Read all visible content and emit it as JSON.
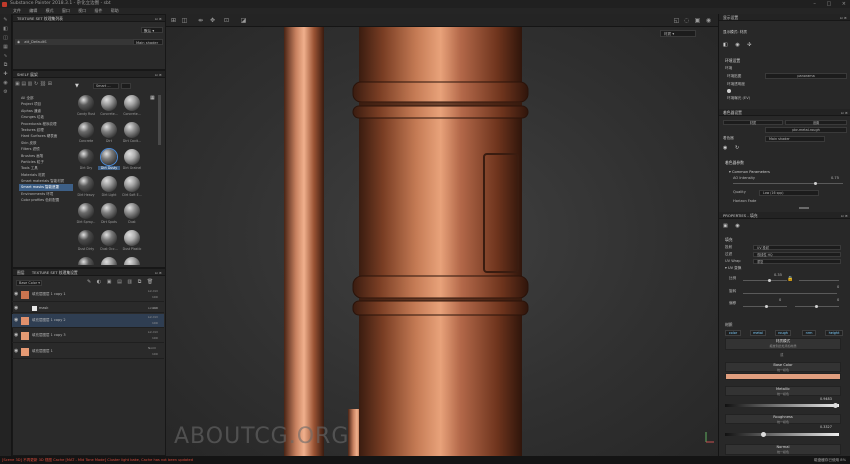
{
  "app": {
    "title": "Substance Painter 2018.3.1 - 杂化立边圈 - sbt",
    "menu": [
      "文件",
      "编辑",
      "模式",
      "窗口",
      "视口",
      "插件",
      "帮助"
    ]
  },
  "texture_set_list": {
    "header": "TEXTURE SET 纹理集列表",
    "dropdown": "默认",
    "item_name": "att_DefaultS",
    "item_shader": "Main shader"
  },
  "shelf": {
    "header": "SHELF 展架",
    "filter": "Smart ...",
    "categories": [
      "All 全部",
      "Project 项目",
      "Alphas 通道",
      "Grunges 垃圾",
      "Procedurals 程序纹理",
      "Textures 纹理",
      "Hard Surfaces 硬表面",
      "Skin 皮肤",
      "Filters 滤镜",
      "Brushes 画笔",
      "Particles 粒子",
      "Tools 工具",
      "Materials 材质",
      "Smart materials 智能材质",
      "Smart masks 智能遮罩",
      "Environments 环境",
      "Color profiles 色彩配置"
    ],
    "selected_category": "Smart masks 智能遮罩",
    "thumbnails": [
      "Candy Rust",
      "Concrete...",
      "Concrete...",
      "Concrete",
      "Dirt",
      "Dirt Cavit...",
      "Dirt Dry",
      "Dirt Dusty",
      "Dirt Grainel",
      "Dirt Heavy",
      "Dirt Light",
      "Dirt Soft E...",
      "Dirt Spray...",
      "Dirt Spots",
      "Dust",
      "Dust Dirty",
      "Dust Occ...",
      "Dust Plastic",
      "",
      "",
      ""
    ],
    "selected_thumbnail": "Dirt Dusty"
  },
  "layers": {
    "tab_layers": "图层",
    "tab_texture_settings": "TEXTURE SET 纹理集设置",
    "channel_dropdown": "Base Color",
    "items": [
      {
        "name": "填充层图层 1 copy 1",
        "blend": "Lin Dd",
        "opacity": "100",
        "color": "#c9744f"
      },
      {
        "name": "mask",
        "blend": "Lin Dd",
        "opacity": "100",
        "color": "#e8e8e8"
      },
      {
        "name": "填充层图层 1 copy 2",
        "blend": "Lin Dd",
        "opacity": "100",
        "color": "#e0906c"
      },
      {
        "name": "填充层图层 1 copy 3",
        "blend": "Lin Dd",
        "opacity": "100",
        "color": "#e49a72"
      },
      {
        "name": "填充层图层 1",
        "blend": "Norm",
        "opacity": "100",
        "color": "#e69a74"
      }
    ]
  },
  "viewport": {
    "view_mode": "材质",
    "watermark": "ABOUTCG.ORG"
  },
  "display_settings": {
    "header": "显示设置",
    "display_mode": "显示模式: 材质",
    "env_section": "环境设置",
    "env_label": "环境",
    "env_map_label": "环境贴图",
    "env_map_value": "panorama",
    "env_opacity": "环境透明度",
    "env_exposure": "环境曝光 (EV)"
  },
  "shader_settings": {
    "header": "着色器设置",
    "tab_a": "材质",
    "tab_b": "设置",
    "shader_file": "pbr-metal-rough",
    "shader_label": "着色器",
    "shader_name": "Main shader",
    "params_header": "着色器参数",
    "common_params": "Common Parameters",
    "ao_intensity_label": "AO Intensity",
    "ao_intensity_value": "0.75",
    "quality_label": "Quality",
    "quality_value": "Low (16 spp)",
    "horizon_fade_label": "Horizon Fade"
  },
  "properties": {
    "header": "PROPERTIES - 填充",
    "fill_section": "填充",
    "projection_label": "投射",
    "projection_value": "UV 投射",
    "filtering_label": "过滤",
    "filtering_value": "双线性 HQ",
    "uv_wrap_label": "UV Wrap",
    "uv_wrap_value": "重复",
    "uv_transform": "UV 变换",
    "scale_label": "比例",
    "scale_value": "0.35",
    "rotation_label": "旋转",
    "rotation_value": "0",
    "offset_label": "偏移",
    "offset_value_x": "0",
    "offset_value_y": "0",
    "material_section": "材质",
    "channels": [
      "color",
      "metal",
      "rough",
      "nrm",
      "height"
    ],
    "material_mode": "材质模式",
    "material_mode_sub": "拖放到此处添加材质",
    "divider_text": "或",
    "base_color_label": "Base Color",
    "base_color_sub": "统一模色",
    "base_color_hex": "#e09e7e",
    "metallic_label": "Metallic",
    "metallic_sub": "统一模色",
    "metallic_value": "0.9483",
    "roughness_label": "Roughness",
    "roughness_sub": "统一模色",
    "roughness_value": "0.3327",
    "normal_label": "Normal",
    "normal_sub": "统一模色"
  },
  "status": {
    "error": "[Scene 3D] 不再更新 3D 视图 Cache [MAT - Mid Tone Mode] Cluster light bake, Cache has not been updated",
    "cache_text": "磁盘缓存已使用 8%"
  }
}
